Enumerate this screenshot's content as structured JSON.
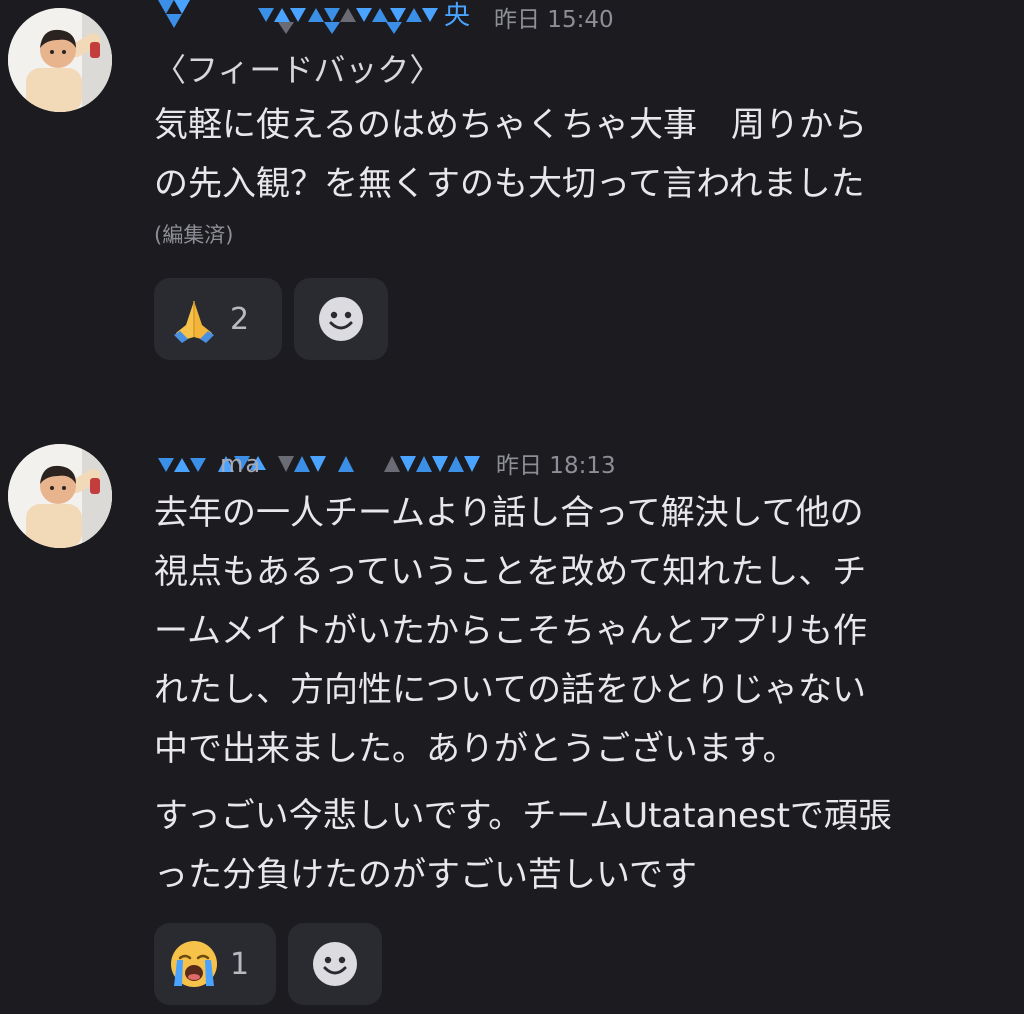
{
  "messages": [
    {
      "username_partial": "央",
      "timestamp": "昨日 15:40",
      "tag": "〈フィードバック〉",
      "lines": [
        "気軽に使えるのはめちゃくちゃ大事　周りから",
        "の先入観？を無くすのも大切って言われました"
      ],
      "edited": "(編集済)",
      "reaction": {
        "icon": "folded-hands-emoji",
        "count": "2"
      }
    },
    {
      "username_partial": "ma",
      "timestamp": "昨日 18:13",
      "lines": [
        "去年の一人チームより話し合って解決して他の",
        "視点もあるっていうことを改めて知れたし、チ",
        "ームメイトがいたからこそちゃんとアプリも作",
        "れたし、方向性についての話をひとりじゃない",
        "中で出来ました。ありがとうございます。"
      ],
      "lines2": [
        "すっごい今悲しいです。チームUtatanestで頑張",
        "った分負けたのがすごい苦しいです"
      ],
      "reaction": {
        "icon": "loudly-crying-face-emoji",
        "count": "1"
      }
    }
  ],
  "colors": {
    "background": "#1b1b20",
    "reaction_bg": "#2a2b31",
    "mosaic_blue": "#4aa3ff",
    "timestamp": "#8e8e96"
  }
}
